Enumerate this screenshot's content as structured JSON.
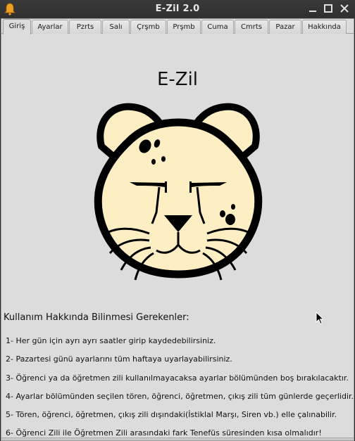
{
  "window": {
    "title": "E-Zil 2.0",
    "icon": "bell-icon",
    "controls": [
      "minimize-icon",
      "maximize-icon",
      "close-icon"
    ]
  },
  "tabs": [
    {
      "label": "Giriş",
      "active": true
    },
    {
      "label": "Ayarlar",
      "active": false
    },
    {
      "label": "Pzrts",
      "active": false
    },
    {
      "label": "Salı",
      "active": false
    },
    {
      "label": "Çrşmb",
      "active": false
    },
    {
      "label": "Prşmb",
      "active": false
    },
    {
      "label": "Cuma",
      "active": false
    },
    {
      "label": "Cmrts",
      "active": false
    },
    {
      "label": "Pazar",
      "active": false
    },
    {
      "label": "Hakkında",
      "active": false
    }
  ],
  "main": {
    "heading": "E-Zil",
    "logo": "cheetah-logo",
    "info_title": "Kullanım Hakkında Bilinmesi Gerekenler:",
    "items": [
      "1- Her gün için ayrı ayrı saatler girip kaydedebilirsiniz.",
      "2- Pazartesi günü ayarlarını tüm haftaya uyarlayabilirsiniz.",
      "3- Öğrenci ya da öğretmen zili kullanılmayacaksa ayarlar bölümünden boş bırakılacaktır.",
      "4- Ayarlar bölümünden seçilen tören, öğrenci, öğretmen, çıkış zili tüm günlerde geçerlidir.",
      "5- Tören, öğrenci, öğretmen, çıkış zili dışındaki(İstiklal Marşı, Siren vb.) elle çalınabilir.",
      "6- Öğrenci Zili ile Öğretmen Zili arasındaki fark Tenefüs süresinden kısa olmalıdır!"
    ]
  },
  "colors": {
    "titlebar": "#2f2f2f",
    "window_bg": "#dcdcdc",
    "logo_fill": "#fdeec4",
    "logo_outline": "#000000",
    "bell": "#f0a020"
  }
}
